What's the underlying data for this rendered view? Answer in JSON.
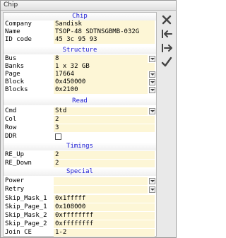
{
  "window": {
    "title": "Chip"
  },
  "sections": {
    "chip": "Chip",
    "structure": "Structure",
    "read": "Read",
    "timings": "Timings",
    "special": "Special"
  },
  "chip": {
    "company": {
      "label": "Company",
      "value": "Sandisk"
    },
    "name": {
      "label": "Name",
      "value": "TSOP-48  SDTNSGBMB-032G"
    },
    "id_code": {
      "label": "ID code",
      "value": "45 3c 95 93"
    }
  },
  "structure": {
    "bus": {
      "label": "Bus",
      "value": "8"
    },
    "banks": {
      "label": "Banks",
      "value": "1 x 32 GB"
    },
    "page": {
      "label": "Page",
      "value": "17664"
    },
    "block": {
      "label": "Block",
      "value": "0x450000"
    },
    "blocks": {
      "label": "Blocks",
      "value": "0x2100"
    }
  },
  "read": {
    "cmd": {
      "label": "Cmd",
      "value": "Std"
    },
    "col": {
      "label": "Col",
      "value": "2"
    },
    "row": {
      "label": "Row",
      "value": "3"
    },
    "ddr": {
      "label": "DDR",
      "checked": false
    }
  },
  "timings": {
    "re_up": {
      "label": "RE_Up",
      "value": "2"
    },
    "re_down": {
      "label": "RE_Down",
      "value": "2"
    }
  },
  "special": {
    "power": {
      "label": "Power",
      "value": ""
    },
    "retry": {
      "label": "Retry",
      "value": ""
    },
    "skip_mask_1": {
      "label": "Skip_Mask_1",
      "value": "0x1fffff"
    },
    "skip_page_1": {
      "label": "Skip_Page_1",
      "value": "0x108000"
    },
    "skip_mask_2": {
      "label": "Skip_Mask_2",
      "value": "0xffffffff"
    },
    "skip_page_2": {
      "label": "Skip_Page_2",
      "value": "0xffffffff"
    },
    "join_ce": {
      "label": "Join CE",
      "value": "1-2"
    }
  },
  "toolbar": {
    "icons": [
      "close-icon",
      "import-icon",
      "export-icon",
      "checkmark-icon"
    ]
  },
  "colors": {
    "section_text": "#1b1bd6",
    "field_bg": "#fdf6d6"
  }
}
